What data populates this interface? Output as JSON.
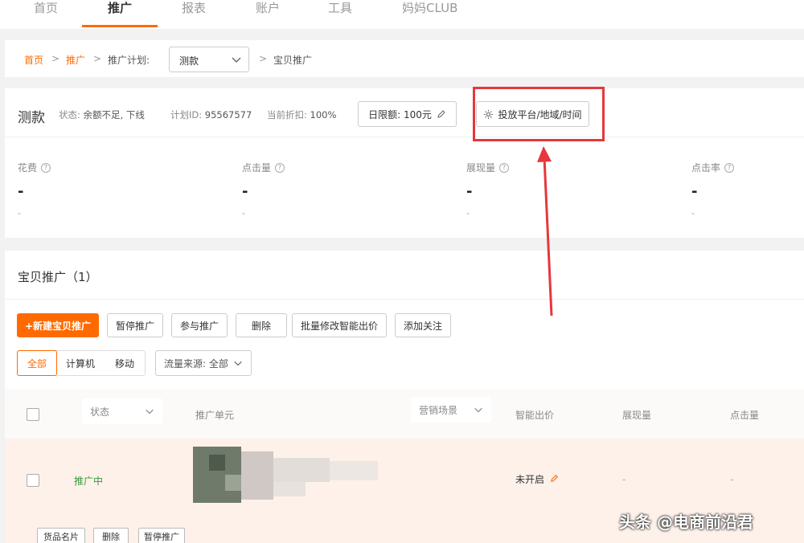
{
  "topnav": {
    "tabs": [
      {
        "label": "首页"
      },
      {
        "label": "推广"
      },
      {
        "label": "报表"
      },
      {
        "label": "账户"
      },
      {
        "label": "工具"
      },
      {
        "label": "妈妈CLUB"
      }
    ],
    "active_tab": "推广"
  },
  "breadcrumb": {
    "home": "首页",
    "promote": "推广",
    "plan_label": "推广计划:",
    "plan_value": "测款",
    "current": "宝贝推广",
    "sep": ">"
  },
  "plan": {
    "name": "测款",
    "status_label": "状态:",
    "status_value": "余额不足, 下线",
    "id_label": "计划ID:",
    "id_value": "95567577",
    "discount_label": "当前折扣:",
    "discount_value": "100%",
    "budget_button": "日限额: 100元",
    "schedule_button": "投放平台/地域/时间"
  },
  "metrics": [
    {
      "label": "花费",
      "value": "-",
      "sub": "-"
    },
    {
      "label": "点击量",
      "value": "-",
      "sub": "-"
    },
    {
      "label": "展现量",
      "value": "-",
      "sub": "-"
    },
    {
      "label": "点击率",
      "value": "-",
      "sub": "-"
    }
  ],
  "list": {
    "title": "宝贝推广（1）",
    "buttons": {
      "new": "+新建宝贝推广",
      "pause": "暂停推广",
      "join": "参与推广",
      "delete": "删除",
      "batch_bid": "批量修改智能出价",
      "follow": "添加关注"
    },
    "segments": [
      "全部",
      "计算机",
      "移动"
    ],
    "active_segment": "全部",
    "source_filter": "流量来源: 全部"
  },
  "table": {
    "headers": {
      "status": "状态",
      "unit": "推广单元",
      "scene": "营销场景",
      "smart_bid": "智能出价",
      "impressions": "展现量",
      "clicks": "点击量"
    },
    "rows": [
      {
        "status": "推广中",
        "smart_bid": "未开启",
        "impressions": "-",
        "clicks": "-",
        "actions": [
          "货品名片",
          "删除",
          "暂停推广"
        ]
      }
    ]
  },
  "watermark": "头条 @电商前沿君",
  "colors": {
    "accent": "#ff6a00",
    "annotation": "#e5383b",
    "status_active": "#3a9a3a"
  }
}
